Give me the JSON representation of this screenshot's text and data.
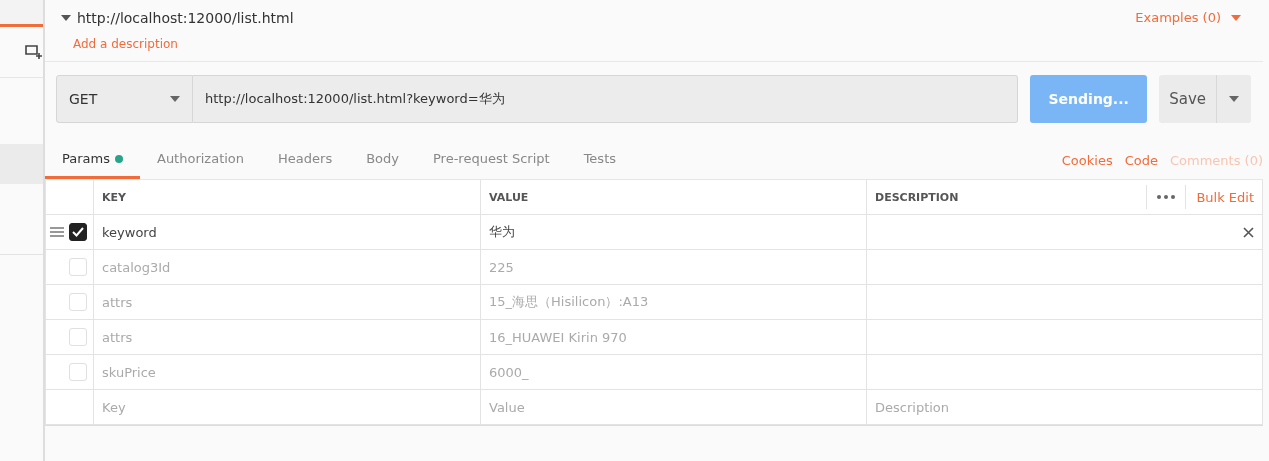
{
  "request": {
    "title": "http://localhost:12000/list.html",
    "description_link": "Add a description",
    "examples": "Examples (0)"
  },
  "url_bar": {
    "method": "GET",
    "url": "http://localhost:12000/list.html?keyword=华为",
    "send": "Sending...",
    "send_busy": true,
    "save": "Save"
  },
  "tabs": [
    {
      "label": "Params",
      "selected": true,
      "dot": true
    },
    {
      "label": "Authorization",
      "selected": false,
      "dot": false
    },
    {
      "label": "Headers",
      "selected": false,
      "dot": false
    },
    {
      "label": "Body",
      "selected": false,
      "dot": false
    },
    {
      "label": "Pre-request Script",
      "selected": false,
      "dot": false
    },
    {
      "label": "Tests",
      "selected": false,
      "dot": false
    }
  ],
  "links": [
    {
      "label": "Cookies",
      "disabled": false
    },
    {
      "label": "Code",
      "disabled": false
    },
    {
      "label": "Comments (0)",
      "disabled": true
    }
  ],
  "table": {
    "columns": [
      "KEY",
      "VALUE",
      "DESCRIPTION"
    ],
    "bulk_edit": "Bulk Edit",
    "rows": [
      {
        "key": "keyword",
        "value": "华为",
        "checked": true,
        "hovered": true
      },
      {
        "key": "catalog3Id",
        "value": "225",
        "checked": false,
        "hovered": false
      },
      {
        "key": "attrs",
        "value": "15_海思（Hisilicon）:A13",
        "checked": false,
        "hovered": false
      },
      {
        "key": "attrs",
        "value": "16_HUAWEI Kirin 970",
        "checked": false,
        "hovered": false
      },
      {
        "key": "skuPrice",
        "value": "6000_",
        "checked": false,
        "hovered": false
      }
    ],
    "new_row": {
      "key_placeholder": "Key",
      "value_placeholder": "Value",
      "description_placeholder": "Description"
    }
  }
}
